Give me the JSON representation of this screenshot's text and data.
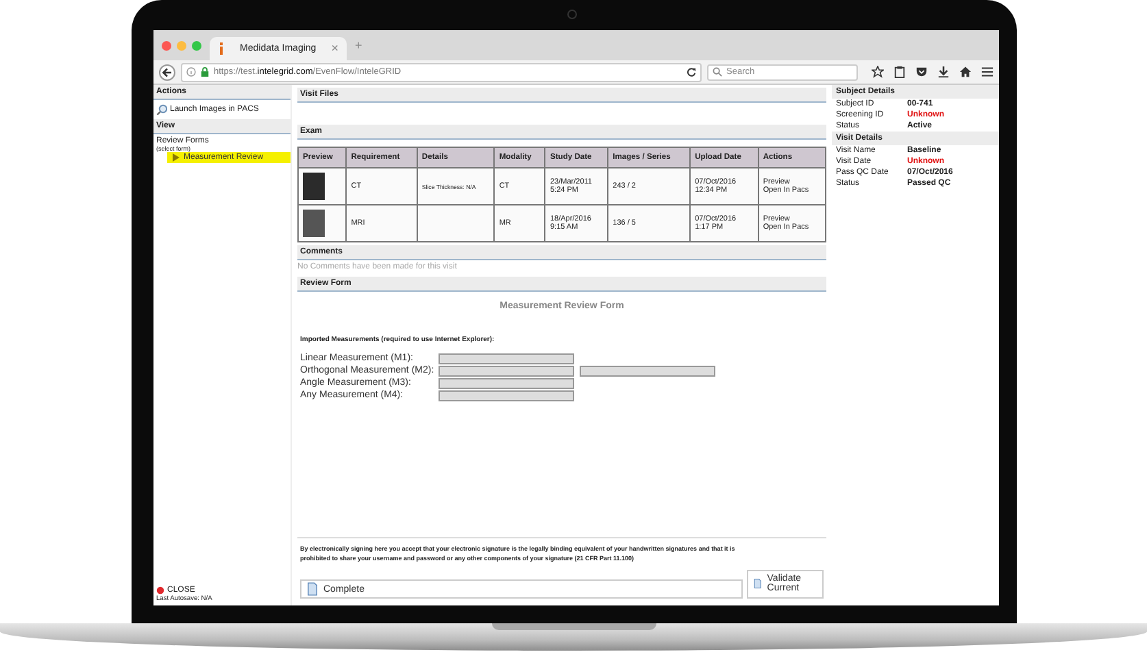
{
  "browser": {
    "tab_title": "Medidata Imaging",
    "tab_close": "×",
    "new_tab": "+",
    "url": "https://test.**intelegrid.com**/EvenFlow/InteleGRID",
    "search_placeholder": "Search"
  },
  "sidebar": {
    "actions_title": "Actions",
    "launch_link": "Launch Images in PACS",
    "view_title": "View",
    "review_forms_label": "Review Forms",
    "select_hint": "(select form)",
    "forms": [
      {
        "label": "Measurement Review",
        "selected": true
      }
    ],
    "close_link": "CLOSE",
    "autosave": "Last Autosave: N/A"
  },
  "main": {
    "visit_files_title": "Visit Files",
    "exam_title": "Exam",
    "table": {
      "columns": [
        "Preview",
        "Requirement",
        "Details",
        "Modality",
        "Study Date",
        "Images / Series",
        "Upload Date",
        "Actions"
      ],
      "rows": [
        {
          "requirement": "CT",
          "details": "Slice Thickness: N/A",
          "modality": "CT",
          "study_date": [
            "23/Mar/2011",
            "5:24 PM"
          ],
          "images": "243 / 2",
          "upload_date": [
            "07/Oct/2016",
            "12:34 PM"
          ],
          "actions": [
            "Preview",
            "Open In Pacs"
          ]
        },
        {
          "requirement": "MRI",
          "details": "",
          "modality": "MR",
          "study_date": [
            "18/Apr/2016",
            "9:15 AM"
          ],
          "images": "136 / 5",
          "upload_date": [
            "07/Oct/2016",
            "1:17 PM"
          ],
          "actions": [
            "Preview",
            "Open In Pacs"
          ]
        }
      ]
    },
    "comments_title": "Comments",
    "comments_empty": "No Comments have been made for this visit",
    "review_form_title": "Review Form",
    "form_title": "Measurement Review Form",
    "imported_label": "Imported Measurements (required to use Internet Explorer):",
    "measurements": [
      {
        "label": "Linear Measurement (M1):",
        "kind": "single"
      },
      {
        "label": "Orthogonal Measurement (M2):",
        "kind": "double"
      },
      {
        "label": "Angle Measurement (M3):",
        "kind": "single"
      },
      {
        "label": "Any Measurement (M4):",
        "kind": "single"
      }
    ],
    "signature_text": "By electronically signing here you accept that your electronic signature is the legally binding equivalent of your handwritten signatures and that it is prohibited to share your username and password or any other components of your signature (21 CFR Part 11.100)",
    "complete_button": "Complete",
    "validate_button": "Validate Current"
  },
  "details": {
    "sections": [
      {
        "title": "Subject Details",
        "fields": [
          {
            "label": "Subject ID",
            "value": "00-741",
            "alert": false
          },
          {
            "label": "Screening ID",
            "value": "Unknown",
            "alert": true
          },
          {
            "label": "Status",
            "value": "Active",
            "alert": false
          }
        ]
      },
      {
        "title": "Visit Details",
        "fields": [
          {
            "label": "Visit Name",
            "value": "Baseline",
            "alert": false
          },
          {
            "label": "Visit Date",
            "value": "Unknown",
            "alert": true
          },
          {
            "label": "Pass QC Date",
            "value": "07/Oct/2016",
            "alert": false
          },
          {
            "label": "Status",
            "value": "Passed QC",
            "alert": false
          }
        ]
      }
    ]
  }
}
